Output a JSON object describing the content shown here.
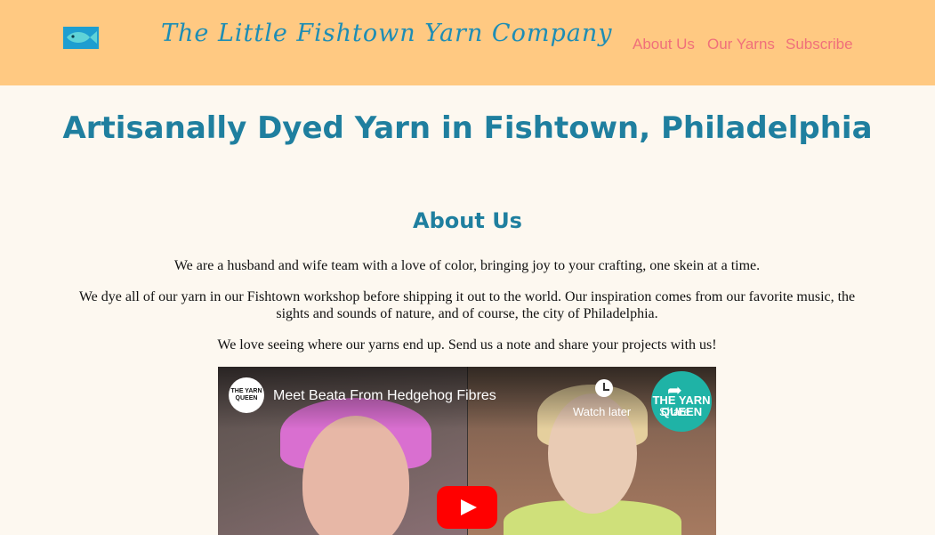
{
  "header": {
    "brand": "The Little Fishtown Yarn Company",
    "nav": {
      "about": "About Us",
      "yarns": "Our Yarns",
      "subscribe": "Subscribe"
    },
    "logo_icon": "fish-icon",
    "bg_color": "#ffc982",
    "nav_color": "#f0707a"
  },
  "hero": {
    "title": "Artisanally Dyed Yarn in Fishtown, Philadelphia"
  },
  "about": {
    "heading": "About Us",
    "paragraphs": [
      "We are a husband and wife team with a love of color, bringing joy to your crafting, one skein at a time.",
      "We dye all of our yarn in our Fishtown workshop before shipping it out to the world. Our inspiration comes from our favorite music, the sights and sounds of nature, and of course, the city of Philadelphia.",
      "We love seeing where our yarns end up. Send us a note and share your projects with us!"
    ]
  },
  "video": {
    "title": "Meet Beata From Hedgehog Fibres",
    "channel_avatar_text": "THE YARN QUEEN",
    "watch_later_label": "Watch later",
    "share_label": "Share",
    "share_badge_text": "THE YARN QUEEN",
    "icons": [
      "clock-icon",
      "share-icon",
      "play-icon"
    ]
  },
  "colors": {
    "heading": "#1f7f9f",
    "page_bg": "#fdf8f0",
    "play": "#ff0000"
  }
}
